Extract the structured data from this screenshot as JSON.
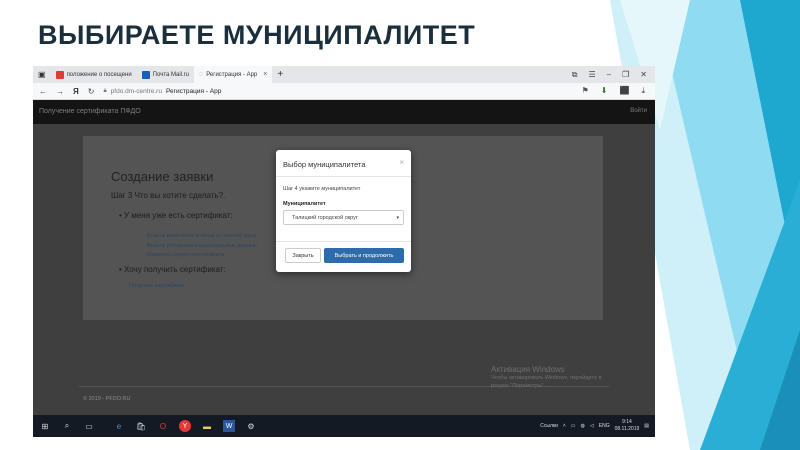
{
  "slide": {
    "title": "ВЫБИРАЕТЕ МУНИЦИПАЛИТЕТ"
  },
  "browser": {
    "tabs": [
      {
        "label": "положение о посещени",
        "icon": "yandex-icon",
        "color": "#e53935"
      },
      {
        "label": "Почта Mail.ru",
        "icon": "mail-icon",
        "color": "#1a5fb4"
      },
      {
        "label": "Регистрация - App",
        "icon": "bulb-icon",
        "color": "#888888"
      }
    ],
    "new_tab": "+",
    "url_domain": "pfdo.dm-centre.ru",
    "url_title": "Регистрация - App"
  },
  "site": {
    "brand": "Получение сертификата ПФДО",
    "login": "Войти",
    "heading": "Создание заявки",
    "step": "Шаг 3 Что вы хотите сделать?.",
    "option_have": "У меня уже есть сертификат:",
    "links": [
      "Внести изменения в связи со сменой муни",
      "Внести уточнения в персональные данные",
      "Изменить группу сертификата"
    ],
    "option_get": "Хочу получить сертификат:",
    "get_link": "Получить сертификат",
    "footer": "© 2019 - PFDO.RU"
  },
  "modal": {
    "title": "Выбор муниципалитета",
    "close_symbol": "×",
    "step": "Шаг 4 укажите муниципалитет",
    "field_label": "Муниципалитет",
    "selected": "Талицкий городской округ",
    "btn_close": "Закрыть",
    "btn_submit": "Выбрать и продолжить"
  },
  "watermark": {
    "title": "Активация Windows",
    "line1": "Чтобы активировать Windows, перейдите в",
    "line2": "раздел \"Параметры\"."
  },
  "taskbar": {
    "links_label": "Ссылки",
    "lang": "ENG",
    "time": "9:14",
    "date": "08.11.2019"
  },
  "colors": {
    "accent": "#2d6bab",
    "title": "#1a2e3b",
    "deco_teal": "#29b6d8"
  }
}
